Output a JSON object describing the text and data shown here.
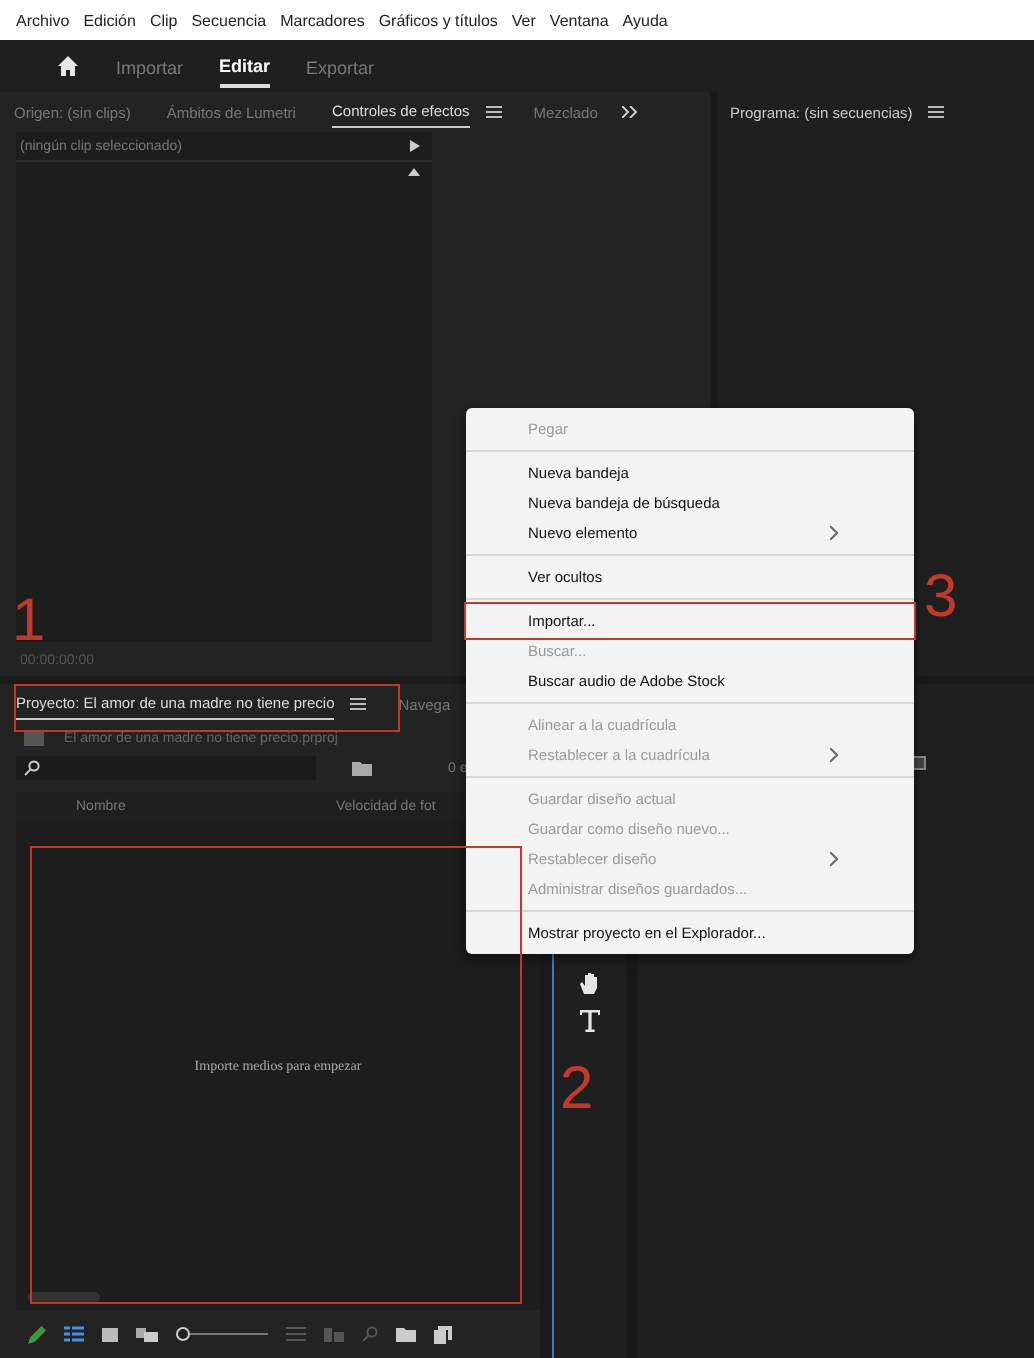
{
  "menubar": [
    "Archivo",
    "Edición",
    "Clip",
    "Secuencia",
    "Marcadores",
    "Gráficos y títulos",
    "Ver",
    "Ventana",
    "Ayuda"
  ],
  "header": {
    "tabs": [
      {
        "label": "Importar",
        "selected": false
      },
      {
        "label": "Editar",
        "selected": true
      },
      {
        "label": "Exportar",
        "selected": false
      }
    ]
  },
  "source_panel": {
    "tabs": [
      {
        "label": "Origen: (sin clips)",
        "selected": false
      },
      {
        "label": "Ámbitos de Lumetri",
        "selected": false
      },
      {
        "label": "Controles de efectos",
        "selected": true
      },
      {
        "label": "Mezclado",
        "selected": false
      }
    ],
    "clip_selector": "(ningún clip seleccionado)",
    "timecode": "00:00:00:00"
  },
  "program_panel": {
    "title": "Programa: (sin secuencias)"
  },
  "project_panel": {
    "tabs": [
      {
        "label": "Proyecto: El amor de una madre no tiene precio",
        "selected": true
      },
      {
        "label": "Navega",
        "selected": false
      }
    ],
    "project_file": "El amor de una madre no tiene precio.prproj",
    "item_count": "0 e",
    "columns": [
      "Nombre",
      "Velocidad de fot"
    ],
    "empty_message": "Importe medios para empezar",
    "zoom_slider": {
      "level": 0
    }
  },
  "context_menu": {
    "items": [
      {
        "kind": "item",
        "label": "Pegar",
        "disabled": true,
        "submenu": false
      },
      {
        "kind": "separator"
      },
      {
        "kind": "item",
        "label": "Nueva bandeja",
        "disabled": false,
        "submenu": false
      },
      {
        "kind": "item",
        "label": "Nueva bandeja de búsqueda",
        "disabled": false,
        "submenu": false
      },
      {
        "kind": "item",
        "label": "Nuevo elemento",
        "disabled": false,
        "submenu": true
      },
      {
        "kind": "separator"
      },
      {
        "kind": "item",
        "label": "Ver ocultos",
        "disabled": false,
        "submenu": false
      },
      {
        "kind": "separator"
      },
      {
        "kind": "item",
        "label": "Importar...",
        "disabled": false,
        "submenu": false
      },
      {
        "kind": "item",
        "label": "Buscar...",
        "disabled": true,
        "submenu": false
      },
      {
        "kind": "item",
        "label": "Buscar audio de Adobe Stock",
        "disabled": false,
        "submenu": false
      },
      {
        "kind": "separator"
      },
      {
        "kind": "item",
        "label": "Alinear a la cuadrícula",
        "disabled": true,
        "submenu": false
      },
      {
        "kind": "item",
        "label": "Restablecer a la cuadrícula",
        "disabled": true,
        "submenu": true
      },
      {
        "kind": "separator"
      },
      {
        "kind": "item",
        "label": "Guardar diseño actual",
        "disabled": true,
        "submenu": false
      },
      {
        "kind": "item",
        "label": "Guardar como diseño nuevo...",
        "disabled": true,
        "submenu": false
      },
      {
        "kind": "item",
        "label": "Restablecer diseño",
        "disabled": true,
        "submenu": true
      },
      {
        "kind": "item",
        "label": "Administrar diseños guardados...",
        "disabled": true,
        "submenu": false
      },
      {
        "kind": "separator"
      },
      {
        "kind": "item",
        "label": "Mostrar proyecto en el Explorador...",
        "disabled": false,
        "submenu": false
      }
    ]
  },
  "annotations": [
    {
      "label": "1"
    },
    {
      "label": "2"
    },
    {
      "label": "3"
    }
  ]
}
